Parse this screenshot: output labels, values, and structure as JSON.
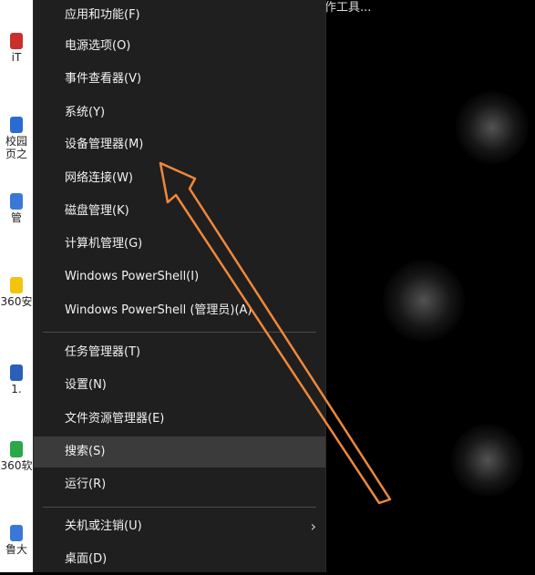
{
  "top_text": "作工具...",
  "desktop_icons": [
    {
      "label": "iT"
    },
    {
      "label": "校园"
    },
    {
      "label": "页之"
    },
    {
      "label": "管"
    },
    {
      "label": "360安"
    },
    {
      "label": "1."
    },
    {
      "label": "360软"
    },
    {
      "label": "鲁大"
    }
  ],
  "menu": {
    "group1": [
      {
        "label": "应用和功能(F)"
      },
      {
        "label": "电源选项(O)"
      },
      {
        "label": "事件查看器(V)"
      },
      {
        "label": "系统(Y)"
      },
      {
        "label": "设备管理器(M)"
      },
      {
        "label": "网络连接(W)"
      },
      {
        "label": "磁盘管理(K)"
      },
      {
        "label": "计算机管理(G)"
      },
      {
        "label": "Windows PowerShell(I)"
      },
      {
        "label": "Windows PowerShell (管理员)(A)"
      }
    ],
    "group2": [
      {
        "label": "任务管理器(T)"
      },
      {
        "label": "设置(N)"
      },
      {
        "label": "文件资源管理器(E)"
      },
      {
        "label": "搜索(S)"
      },
      {
        "label": "运行(R)"
      }
    ],
    "group3": [
      {
        "label": "关机或注销(U)",
        "chevron": "›"
      },
      {
        "label": "桌面(D)"
      }
    ]
  },
  "colors": {
    "menu_bg": "#1f1f1f",
    "hover_bg": "#3b3b3b",
    "arrow": "#f0883a"
  },
  "icons": {
    "submenu": "chevron-right-icon"
  }
}
